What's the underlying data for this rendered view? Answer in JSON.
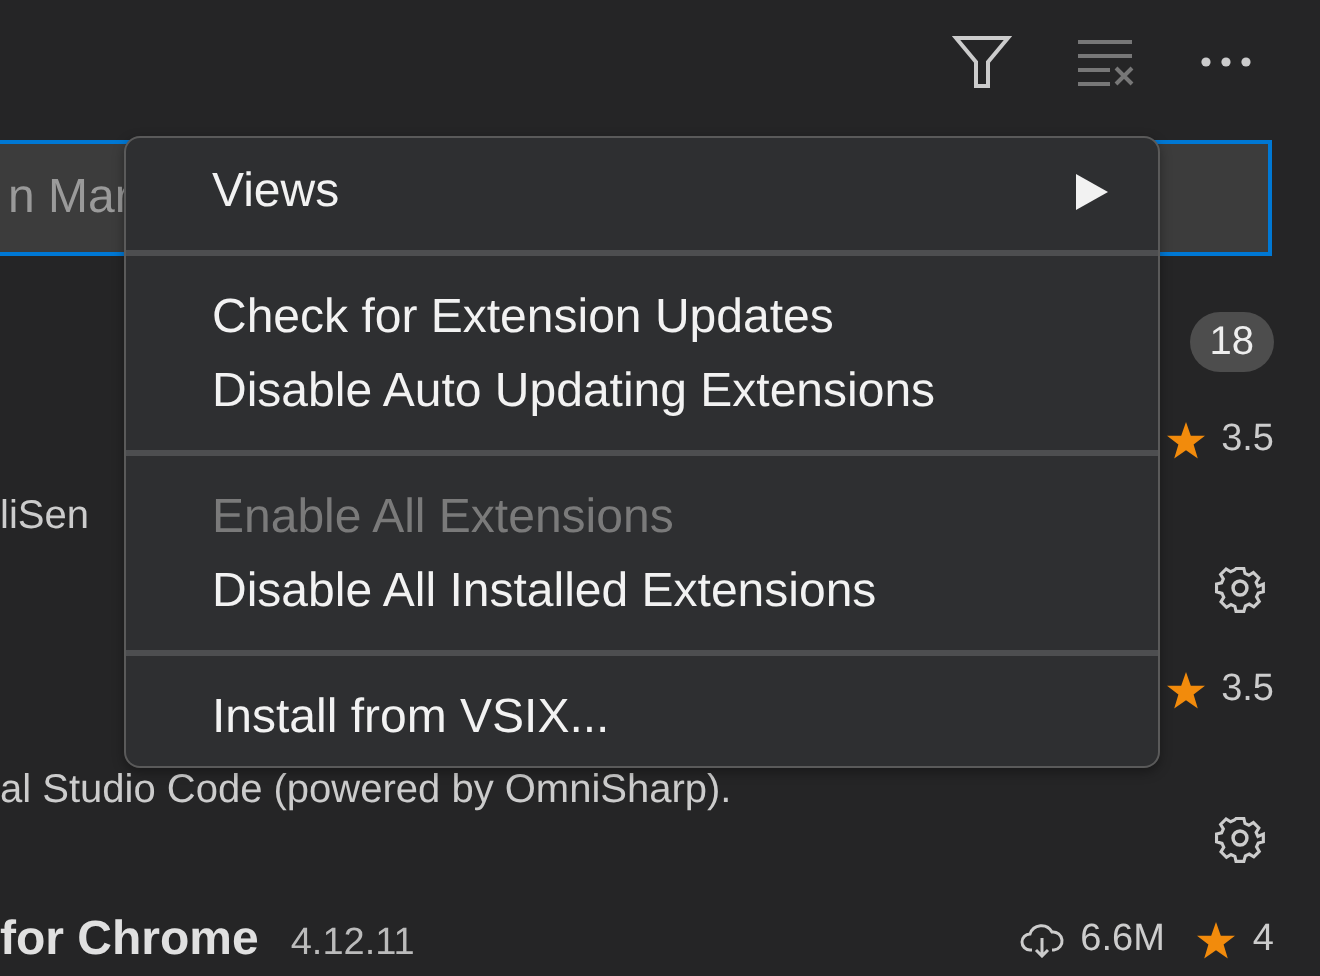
{
  "toolbar": [
    {
      "kind": "filter",
      "disabled": false
    },
    {
      "kind": "clear",
      "disabled": true
    },
    {
      "kind": "more",
      "disabled": false
    }
  ],
  "search": {
    "placeholder": "n Mar"
  },
  "section": {
    "count": "18"
  },
  "extensions": [
    {
      "rating": "3.5",
      "description": "liSen",
      "manage": true
    },
    {
      "rating": "3.5",
      "description": "al Studio Code (powered by OmniSharp).",
      "manage": true
    },
    {
      "name": "for Chrome",
      "version": "4.12.11",
      "downloads": "6.6M",
      "rating": "4"
    }
  ],
  "menu": [
    {
      "kind": "submenu",
      "label": "Views",
      "disabled": false
    },
    {
      "kind": "separator"
    },
    {
      "kind": "item",
      "label": "Check for Extension Updates",
      "disabled": false
    },
    {
      "kind": "item",
      "label": "Disable Auto Updating Extensions",
      "disabled": false
    },
    {
      "kind": "separator"
    },
    {
      "kind": "item",
      "label": "Enable All Extensions",
      "disabled": true
    },
    {
      "kind": "item",
      "label": "Disable All Installed Extensions",
      "disabled": false
    },
    {
      "kind": "separator"
    },
    {
      "kind": "item",
      "label": "Install from VSIX...",
      "disabled": false
    }
  ]
}
